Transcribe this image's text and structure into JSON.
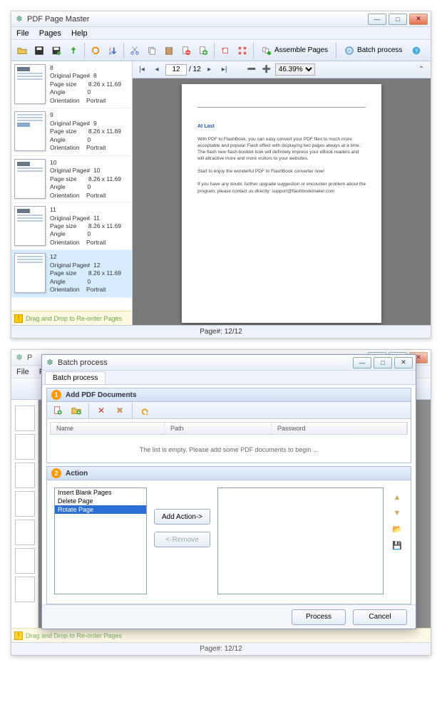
{
  "app": {
    "title": "PDF Page Master"
  },
  "menu": {
    "file": "File",
    "pages": "Pages",
    "help": "Help"
  },
  "toolbar": {
    "assemble": "Assemble Pages",
    "batch": "Batch process"
  },
  "viewerbar": {
    "page_input": "12",
    "page_total": "/ 12",
    "zoom": "46.39%"
  },
  "thumbs": [
    {
      "n": "8",
      "orig": "8",
      "size": "8.26 x 11.69",
      "angle": "0",
      "orient": "Portrait"
    },
    {
      "n": "9",
      "orig": "9",
      "size": "8.26 x 11.69",
      "angle": "0",
      "orient": "Portrait"
    },
    {
      "n": "10",
      "orig": "10",
      "size": "8.26 x 11.69",
      "angle": "0",
      "orient": "Portrait"
    },
    {
      "n": "11",
      "orig": "11",
      "size": "8.26 x 11.69",
      "angle": "0",
      "orient": "Portrait"
    },
    {
      "n": "12",
      "orig": "12",
      "size": "8.26 x 11.69",
      "angle": "0",
      "orient": "Portrait"
    }
  ],
  "meta_labels": {
    "orig": "Original Page#",
    "size": "Page size",
    "angle": "Angle",
    "orient": "Orientation"
  },
  "side_hint": "Drag and Drop to Re-order Pages",
  "doc": {
    "heading": "At Last",
    "p1": "With PDF to FlashBook, you can easy convert your PDF files to much more acceptable and popular Flash effect with displaying two pages always at a time. The flash new flash booklet look will definitely impress your eBook readers and will attractive more and more visitors to your websites.",
    "p2": "Start to enjoy the wonderful PDF to FlashBook converter now!",
    "p3": "If you have any doubt, further upgrade suggestion or encounter problem about the program, please contact us directly: support@flashbookmaker.com"
  },
  "status": "Page#: 12/12",
  "batch": {
    "title": "Batch process",
    "tab": "Batch process",
    "sec1": "Add PDF Documents",
    "sec2": "Action",
    "cols": {
      "name": "Name",
      "path": "Path",
      "password": "Password"
    },
    "empty": "The list is empty. Please add some PDF documents to begin ...",
    "actions": [
      "Insert Blank Pages",
      "Delete Page",
      "Rotate Page"
    ],
    "add_action": "Add Action->",
    "remove": "<-Remove",
    "process": "Process",
    "cancel": "Cancel"
  }
}
